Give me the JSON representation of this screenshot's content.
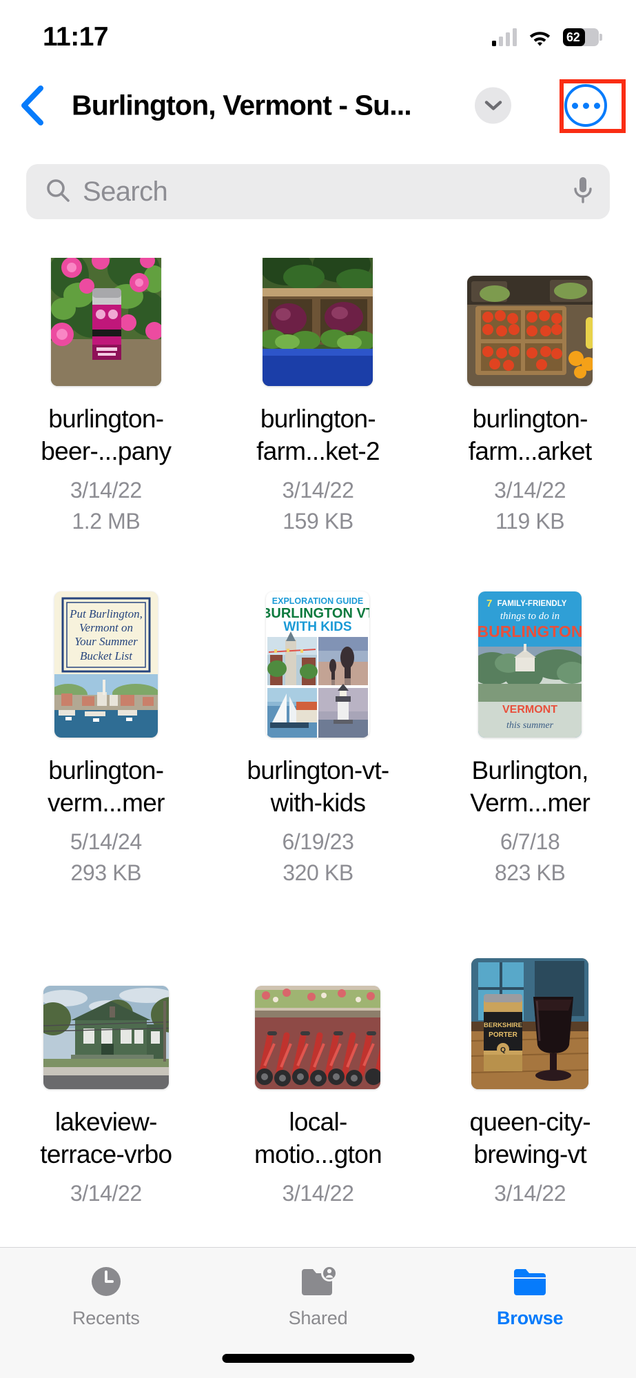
{
  "status_bar": {
    "time": "11:17",
    "battery_percent": "62",
    "battery_level": 62,
    "cellular_icon": "cellular-bars-icon",
    "wifi_icon": "wifi-icon",
    "battery_icon": "battery-icon"
  },
  "nav": {
    "back_icon": "chevron-left-icon",
    "title": "Burlington, Vermont - Su...",
    "chevron_icon": "chevron-down-icon",
    "more_icon": "ellipsis-circle-icon",
    "accent_color": "#067bfb",
    "annotation_color": "#fa2d13"
  },
  "search": {
    "placeholder": "Search",
    "icon": "search-icon",
    "mic_icon": "microphone-icon"
  },
  "files": [
    {
      "name": "burlington-beer-...pany",
      "date": "3/14/22",
      "size": "1.2 MB",
      "thumb": "beer-can-pink-flowers"
    },
    {
      "name": "burlington-farm...ket-2",
      "date": "3/14/22",
      "size": "159 KB",
      "thumb": "farmers-market-greens"
    },
    {
      "name": "burlington-farm...arket",
      "date": "3/14/22",
      "size": "119 KB",
      "thumb": "farmers-market-tomatoes"
    },
    {
      "name": "burlington-verm...mer",
      "date": "5/14/24",
      "size": "293 KB",
      "thumb": "summer-bucket-list-pin"
    },
    {
      "name": "burlington-vt-with-kids",
      "date": "6/19/23",
      "size": "320 KB",
      "thumb": "exploration-guide-kids-pin"
    },
    {
      "name": "Burlington, Verm...mer",
      "date": "6/7/18",
      "size": "823 KB",
      "thumb": "family-friendly-pin"
    },
    {
      "name": "lakeview-terrace-vrbo",
      "date": "3/14/22",
      "size": "",
      "thumb": "green-house-street"
    },
    {
      "name": "local-motio...gton",
      "date": "3/14/22",
      "size": "",
      "thumb": "red-bicycles-rack"
    },
    {
      "name": "queen-city-brewing-vt",
      "date": "3/14/22",
      "size": "",
      "thumb": "beer-can-and-glass"
    }
  ],
  "tabs": [
    {
      "label": "Recents",
      "icon": "clock-icon",
      "active": false
    },
    {
      "label": "Shared",
      "icon": "shared-folder-icon",
      "active": false
    },
    {
      "label": "Browse",
      "icon": "folder-icon",
      "active": true
    }
  ]
}
